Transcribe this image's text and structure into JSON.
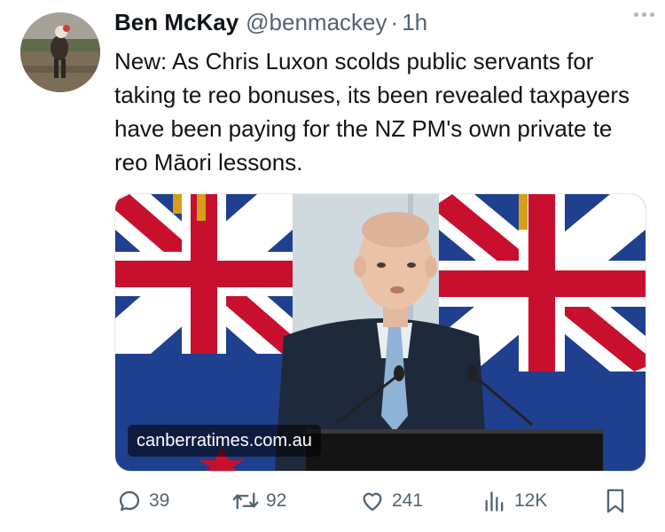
{
  "author": {
    "name": "Ben McKay",
    "handle": "@benmackey",
    "separator": "·",
    "time": "1h"
  },
  "tweet": {
    "text": "New: As Chris Luxon scolds public servants for taking te reo bonuses, its been revealed taxpayers have been paying for the NZ PM's own private te reo Māori lessons."
  },
  "media": {
    "source_label": "canberratimes.com.au"
  },
  "actions": {
    "replies": "39",
    "retweets": "92",
    "likes": "241",
    "views": "12K"
  },
  "icons": {
    "more": "more-dots-icon",
    "reply": "reply-icon",
    "retweet": "retweet-icon",
    "like": "heart-icon",
    "views": "views-icon",
    "bookmark": "bookmark-icon"
  },
  "colors": {
    "text": "#0f1419",
    "secondary": "#536471"
  }
}
